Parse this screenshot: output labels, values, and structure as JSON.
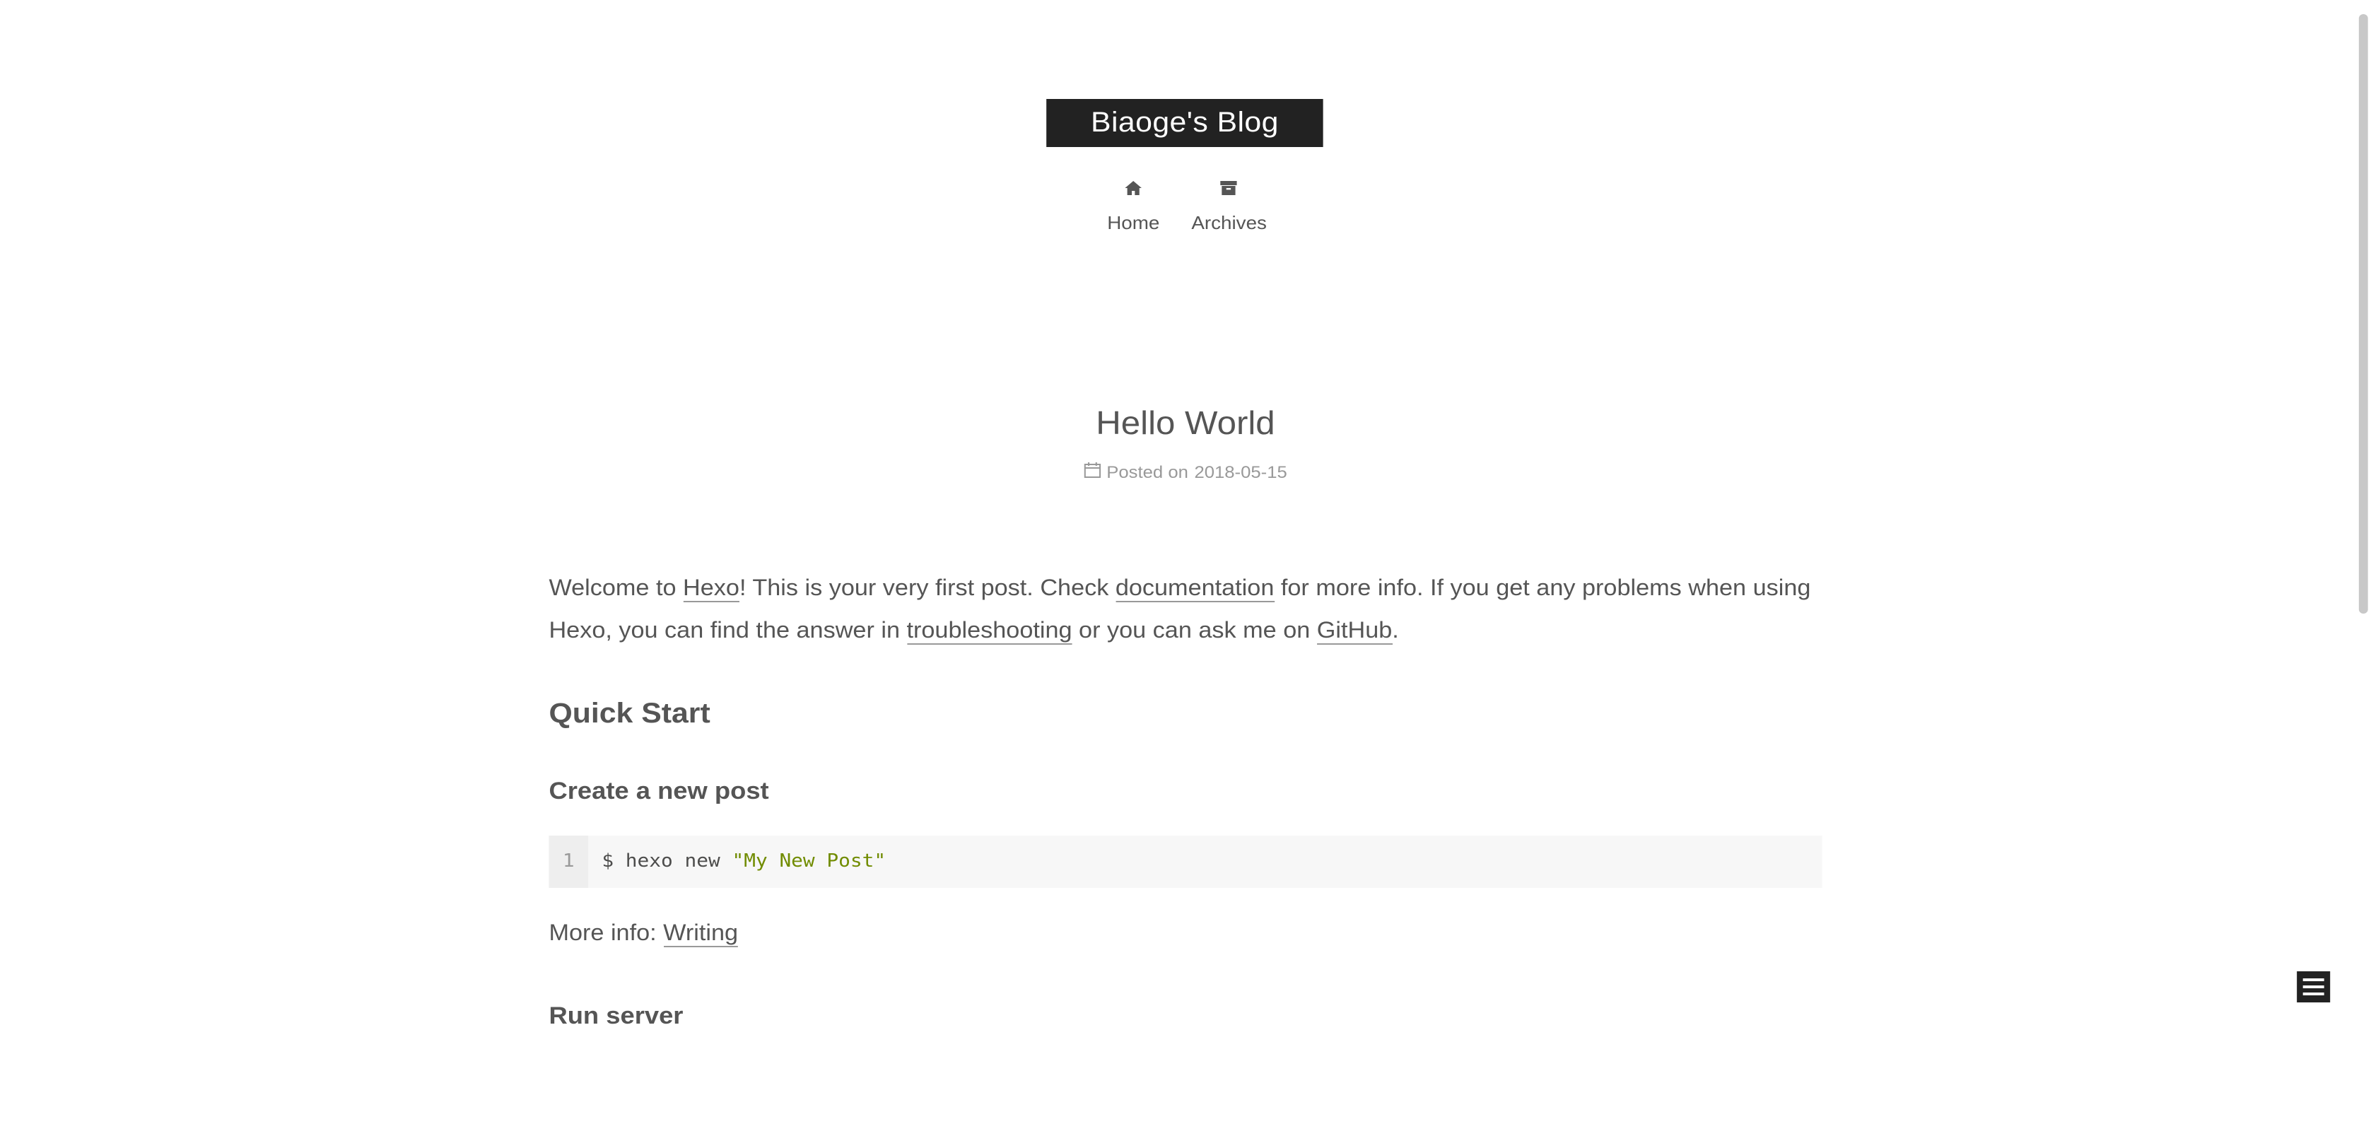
{
  "site": {
    "title": "Biaoge's Blog"
  },
  "menu": {
    "items": [
      {
        "label": "Home",
        "icon": "home-icon"
      },
      {
        "label": "Archives",
        "icon": "archive-icon"
      }
    ]
  },
  "post": {
    "title": "Hello World",
    "meta_prefix": "Posted on",
    "date": "2018-05-15",
    "intro": {
      "t1": "Welcome to ",
      "link_hexo": "Hexo",
      "t2": "! This is your very first post. Check ",
      "link_docs": "documentation",
      "t3": " for more info. If you get any problems when using Hexo, you can find the answer in ",
      "link_troubleshooting": "troubleshooting",
      "t4": " or you can ask me on ",
      "link_github": "GitHub",
      "t5": "."
    },
    "h_quick_start": "Quick Start",
    "h_create_post": "Create a new post",
    "code": {
      "line_number": "1",
      "command": "$ hexo new ",
      "string": "\"My New Post\""
    },
    "more_info_label": "More info: ",
    "more_info_link": "Writing",
    "h_run_server": "Run server"
  }
}
